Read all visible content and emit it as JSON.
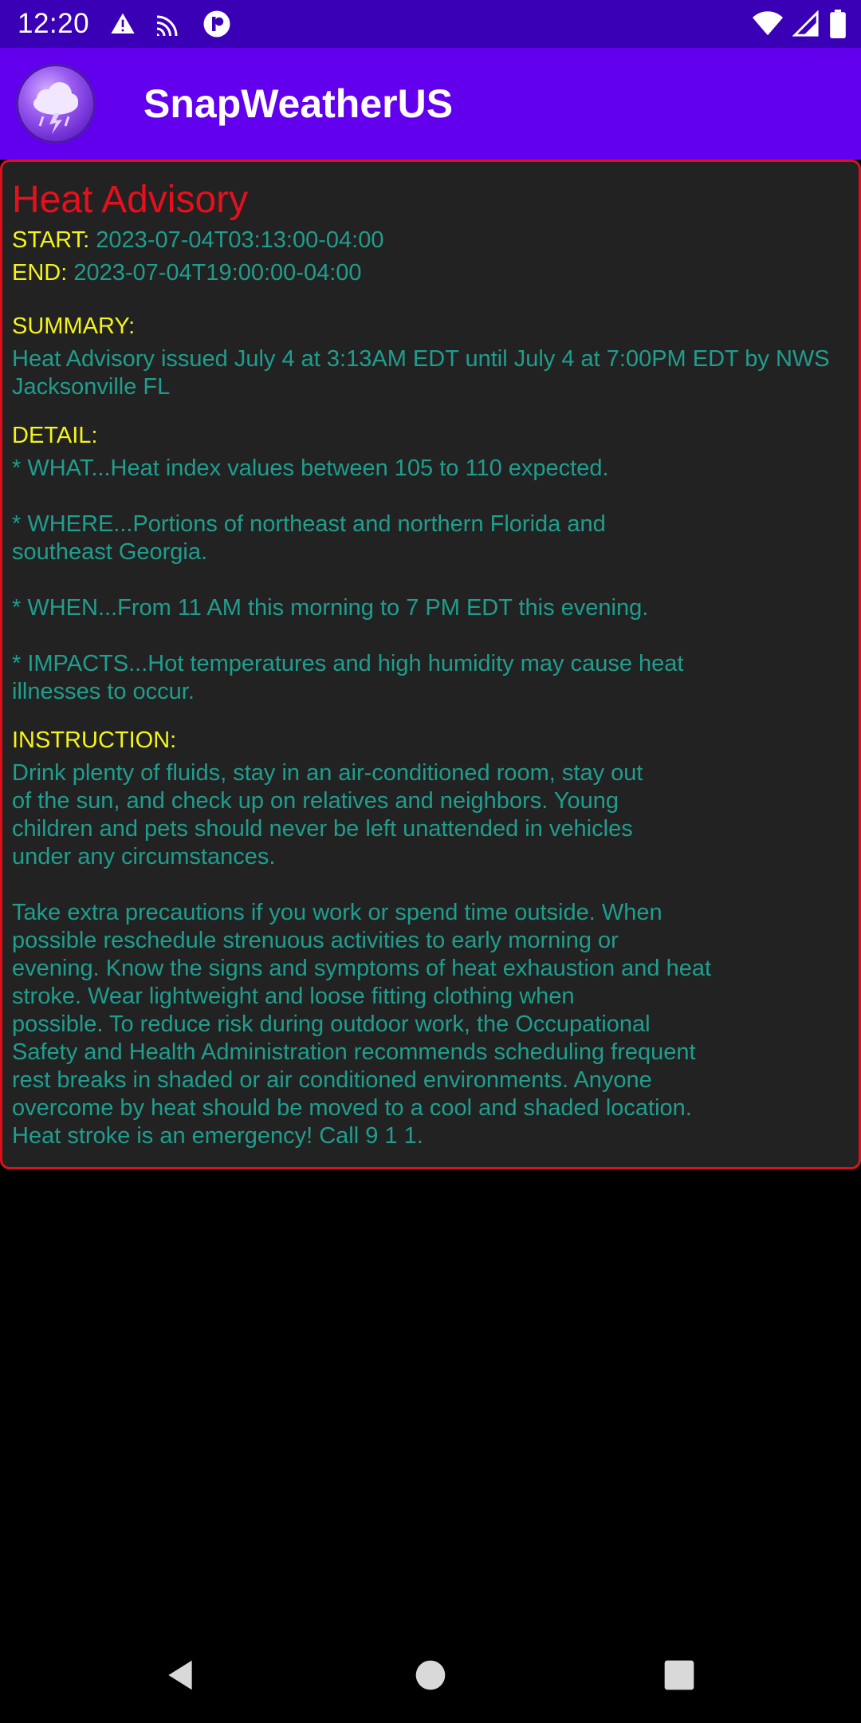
{
  "status_bar": {
    "time": "12:20",
    "left_icons": [
      "alert-icon",
      "cast-icon",
      "app-notification-icon"
    ],
    "right_icons": [
      "wifi-icon",
      "signal-icon",
      "battery-icon"
    ]
  },
  "app_bar": {
    "title": "SnapWeatherUS",
    "logo_icon": "storm-cloud-icon"
  },
  "alert": {
    "title": "Heat Advisory",
    "start_label": "START: ",
    "start_value": "2023-07-04T03:13:00-04:00",
    "end_label": "END: ",
    "end_value": "2023-07-04T19:00:00-04:00",
    "summary_label": "SUMMARY:",
    "summary_text": "Heat Advisory issued July 4 at 3:13AM EDT until July 4 at 7:00PM EDT by NWS Jacksonville FL",
    "detail_label": "DETAIL:",
    "detail_text": "* WHAT...Heat index values between 105 to 110 expected.\n\n* WHERE...Portions of northeast and northern Florida and\nsoutheast Georgia.\n\n* WHEN...From 11 AM this morning to 7 PM EDT this evening.\n\n* IMPACTS...Hot temperatures and high humidity may cause heat\nillnesses to occur.",
    "instruction_label": "INSTRUCTION:",
    "instruction_text": "Drink plenty of fluids, stay in an air-conditioned room, stay out\nof the sun, and check up on relatives and neighbors. Young\nchildren and pets should never be left unattended in vehicles\nunder any circumstances.\n\nTake extra precautions if you work or spend time outside. When\npossible reschedule strenuous activities to early morning or\nevening. Know the signs and symptoms of heat exhaustion and heat\nstroke. Wear lightweight and loose fitting clothing when\npossible. To reduce risk during outdoor work, the Occupational\nSafety and Health Administration recommends scheduling frequent\nrest breaks in shaded or air conditioned environments. Anyone\novercome by heat should be moved to a cool and shaded location.\nHeat stroke is an emergency! Call 9 1 1."
  },
  "colors": {
    "status_bar": "#3a00b6",
    "app_bar": "#6200ee",
    "card_border": "#e0101b",
    "title_red": "#e6101c",
    "label_yellow": "#f4f41a",
    "text_teal": "#1f9e8e"
  },
  "nav_bar": {
    "icons": [
      "back-icon",
      "home-icon",
      "recents-icon"
    ]
  }
}
